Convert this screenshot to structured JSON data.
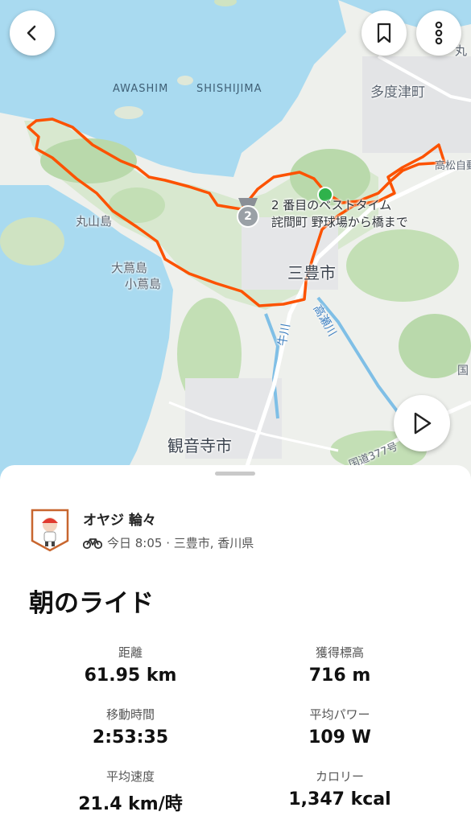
{
  "map": {
    "place_labels": {
      "awashima": "AWASHIM",
      "shishijima": "SHISHIJIMA",
      "tadotsu": "多度津町",
      "takamatsu_road": "高松自動",
      "maruyama": "丸山島",
      "ogushima": "大蔦島",
      "kogushima": "小蔦島",
      "mitoyo": "三豊市",
      "takase_river": "高瀬川",
      "kuse_river": "牛川",
      "kanonji": "観音寺市",
      "national_road": "国道377号",
      "edge_char_top": "丸",
      "edge_char_right": "国"
    },
    "segment": {
      "line1": "2 番目のベストタイム",
      "line2": "詫間町 野球場から橋まで",
      "badge": "2"
    }
  },
  "toolbar": {
    "back": "back-chevron-icon",
    "bookmark": "bookmark-icon",
    "more": "more-vertical-icon",
    "play": "play-icon"
  },
  "activity": {
    "athlete": "オヤジ 輪々",
    "meta": "今日 8:05 · 三豊市, 香川県",
    "title": "朝のライド",
    "accent": "#fc5200"
  },
  "stats": [
    {
      "label": "距離",
      "value": "61.95 km"
    },
    {
      "label": "獲得標高",
      "value": "716 m"
    },
    {
      "label": "移動時間",
      "value": "2:53:35"
    },
    {
      "label": "平均パワー",
      "value": "109 W"
    },
    {
      "label": "平均速度",
      "value": "21.4 km/時"
    },
    {
      "label": "カロリー",
      "value": "1,347 kcal"
    }
  ]
}
